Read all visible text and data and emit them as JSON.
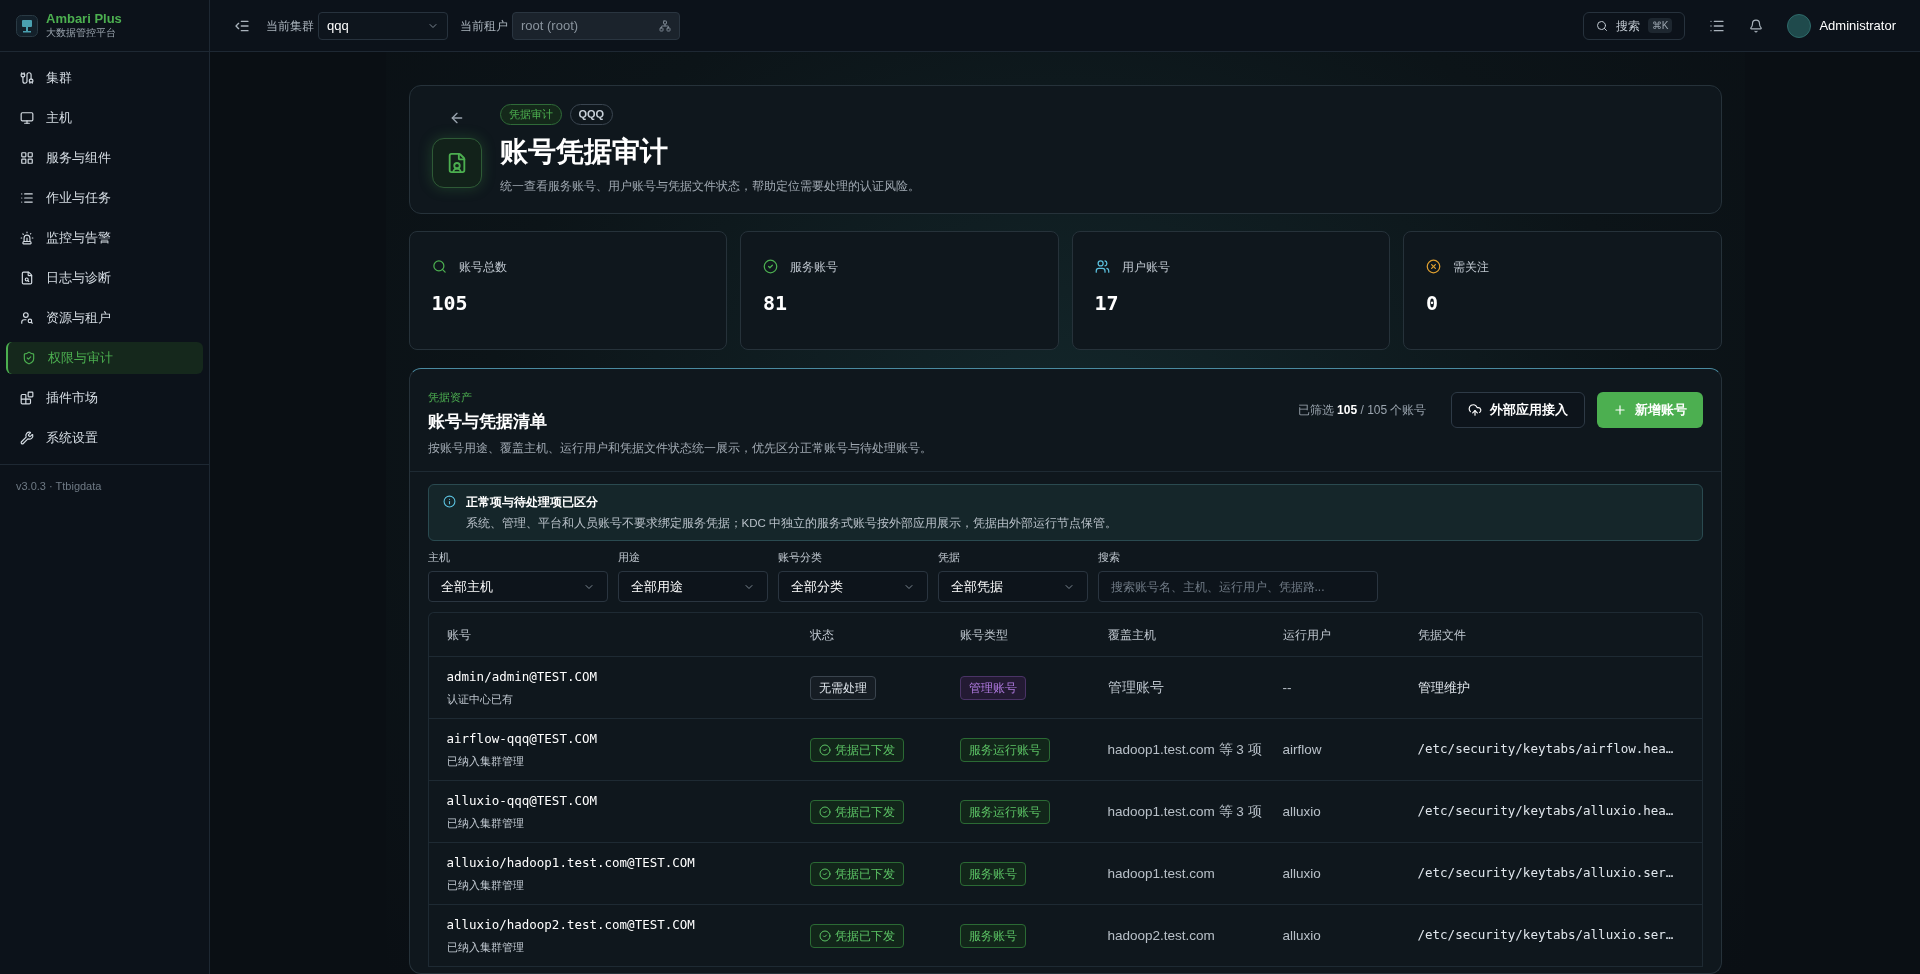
{
  "brand": {
    "title": "Ambari Plus",
    "subtitle": "大数据管控平台"
  },
  "sidebar": {
    "items": [
      {
        "label": "集群",
        "selected": false
      },
      {
        "label": "主机",
        "selected": false
      },
      {
        "label": "服务与组件",
        "selected": false
      },
      {
        "label": "作业与任务",
        "selected": false
      },
      {
        "label": "监控与告警",
        "selected": false
      },
      {
        "label": "日志与诊断",
        "selected": false
      },
      {
        "label": "资源与租户",
        "selected": false
      },
      {
        "label": "权限与审计",
        "selected": true
      },
      {
        "label": "插件市场",
        "selected": false
      },
      {
        "label": "系统设置",
        "selected": false
      }
    ],
    "version": "v3.0.3 · Ttbigdata"
  },
  "topbar": {
    "cluster_label": "当前集群",
    "cluster_value": "qqq",
    "tenant_label": "当前租户",
    "tenant_value": "root (root)",
    "search_label": "搜索",
    "search_shortcut": "⌘K",
    "user": "Administrator"
  },
  "header": {
    "tags": [
      "凭据审计",
      "QQQ"
    ],
    "title": "账号凭据审计",
    "description": "统一查看服务账号、用户账号与凭据文件状态，帮助定位需要处理的认证风险。"
  },
  "stats": [
    {
      "label": "账号总数",
      "value": "105",
      "kind": "total"
    },
    {
      "label": "服务账号",
      "value": "81",
      "kind": "service"
    },
    {
      "label": "用户账号",
      "value": "17",
      "kind": "user"
    },
    {
      "label": "需关注",
      "value": "0",
      "kind": "attention"
    }
  ],
  "list": {
    "eyebrow": "凭据资产",
    "title": "账号与凭据清单",
    "description": "按账号用途、覆盖主机、运行用户和凭据文件状态统一展示，优先区分正常账号与待处理账号。",
    "filtered_prefix": "已筛选",
    "filtered_count": "105",
    "filtered_suffix": "/ 105 个账号",
    "buttons": [
      {
        "label": "外部应用接入",
        "kind": "secondary"
      },
      {
        "label": "新增账号",
        "kind": "primary"
      }
    ],
    "notice": {
      "title": "正常项与待处理项已区分",
      "text": "系统、管理、平台和人员账号不要求绑定服务凭据；KDC 中独立的服务式账号按外部应用展示，凭据由外部运行节点保管。"
    },
    "filters": [
      {
        "label": "主机",
        "value": "全部主机",
        "kind": "select"
      },
      {
        "label": "用途",
        "value": "全部用途",
        "kind": "select"
      },
      {
        "label": "账号分类",
        "value": "全部分类",
        "kind": "select"
      },
      {
        "label": "凭据",
        "value": "全部凭据",
        "kind": "select"
      },
      {
        "label": "搜索",
        "placeholder": "搜索账号名、主机、运行用户、凭据路...",
        "kind": "search"
      }
    ]
  },
  "table": {
    "columns": [
      "账号",
      "状态",
      "账号类型",
      "覆盖主机",
      "运行用户",
      "凭据文件"
    ],
    "rows": [
      {
        "account": "admin/admin@TEST.COM",
        "note": "认证中心已有",
        "status": {
          "label": "无需处理",
          "kind": "none"
        },
        "type": {
          "label": "管理账号",
          "kind": "admin"
        },
        "hosts": "管理账号",
        "run_user": "--",
        "file": "管理维护",
        "kind": "text"
      },
      {
        "account": "airflow-qqq@TEST.COM",
        "note": "已纳入集群管理",
        "status": {
          "label": "凭据已下发",
          "kind": "issued"
        },
        "type": {
          "label": "服务运行账号",
          "kind": "service"
        },
        "hosts": "hadoop1.test.com 等 3 项",
        "run_user": "airflow",
        "file": "/etc/security/keytabs/airflow.hea…",
        "kind": "path"
      },
      {
        "account": "alluxio-qqq@TEST.COM",
        "note": "已纳入集群管理",
        "status": {
          "label": "凭据已下发",
          "kind": "issued"
        },
        "type": {
          "label": "服务运行账号",
          "kind": "service"
        },
        "hosts": "hadoop1.test.com 等 3 项",
        "run_user": "alluxio",
        "file": "/etc/security/keytabs/alluxio.hea…",
        "kind": "path"
      },
      {
        "account": "alluxio/hadoop1.test.com@TEST.COM",
        "note": "已纳入集群管理",
        "status": {
          "label": "凭据已下发",
          "kind": "issued"
        },
        "type": {
          "label": "服务账号",
          "kind": "service"
        },
        "hosts": "hadoop1.test.com",
        "run_user": "alluxio",
        "file": "/etc/security/keytabs/alluxio.ser…",
        "kind": "path"
      },
      {
        "account": "alluxio/hadoop2.test.com@TEST.COM",
        "note": "已纳入集群管理",
        "status": {
          "label": "凭据已下发",
          "kind": "issued"
        },
        "type": {
          "label": "服务账号",
          "kind": "service"
        },
        "hosts": "hadoop2.test.com",
        "run_user": "alluxio",
        "file": "/etc/security/keytabs/alluxio.ser…",
        "kind": "path"
      }
    ]
  }
}
